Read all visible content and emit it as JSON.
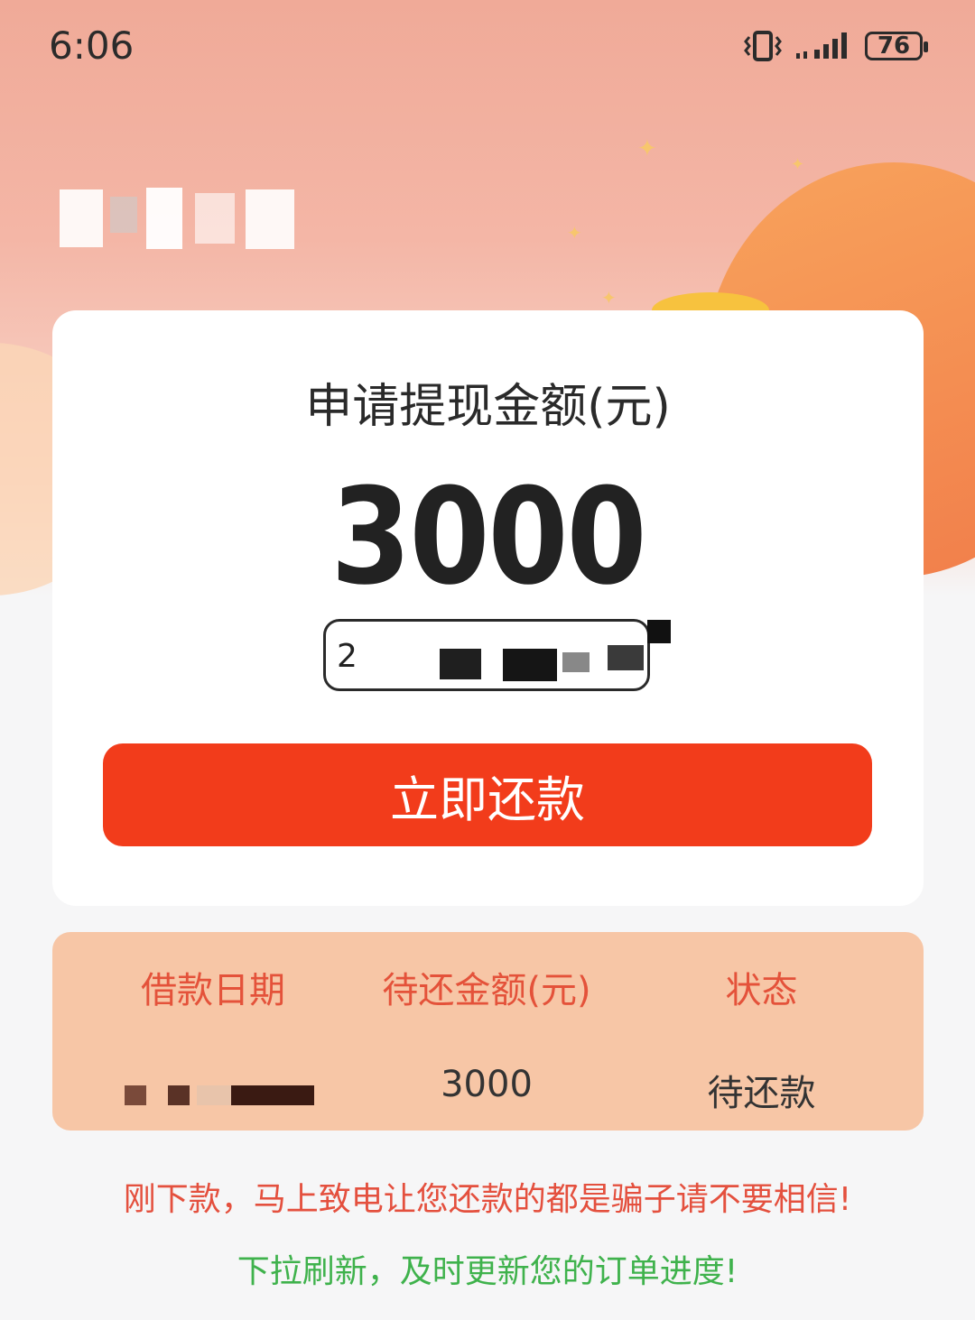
{
  "status_bar": {
    "time": "6:06",
    "battery": "76"
  },
  "card": {
    "label": "申请提现金额(元)",
    "amount": "3000",
    "code_visible_char": "2",
    "repay_button_label": "立即还款"
  },
  "orders": {
    "headers": [
      "借款日期",
      "待还金额(元)",
      "状态"
    ],
    "rows": [
      {
        "amount": "3000",
        "status": "待还款"
      }
    ]
  },
  "warning": "刚下款，马上致电让您还款的都是骗子请不要相信!",
  "refresh_tip": "下拉刷新，及时更新您的订单进度!",
  "colors": {
    "accent": "#f23c1b",
    "warning_text": "#e4503e",
    "tip_text": "#3fb24c",
    "table_bg": "#f7c6a6",
    "table_header": "#e4523a"
  },
  "icons": [
    "vibrate-icon",
    "signal-icon",
    "battery-icon"
  ]
}
